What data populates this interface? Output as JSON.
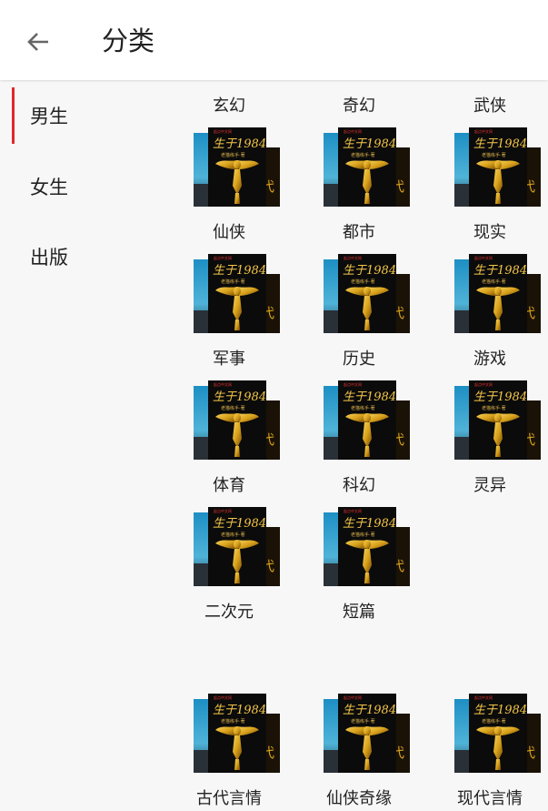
{
  "header": {
    "title": "分类"
  },
  "sidebar": {
    "items": [
      {
        "label": "男生",
        "active": true
      },
      {
        "label": "女生",
        "active": false
      },
      {
        "label": "出版",
        "active": false
      }
    ]
  },
  "cover": {
    "badge": "起点中文网",
    "title": "生于1984",
    "author": "老猫练手·著"
  },
  "categories": [
    "玄幻",
    "奇幻",
    "武侠",
    "仙侠",
    "都市",
    "现实",
    "军事",
    "历史",
    "游戏",
    "体育",
    "科幻",
    "灵异",
    "二次元",
    "短篇",
    "古代言情",
    "仙侠奇缘",
    "现代言情"
  ],
  "colors": {
    "accent": "#e0292c",
    "cover_bg": "#0b0b0b",
    "gold": "#d9a21c"
  }
}
